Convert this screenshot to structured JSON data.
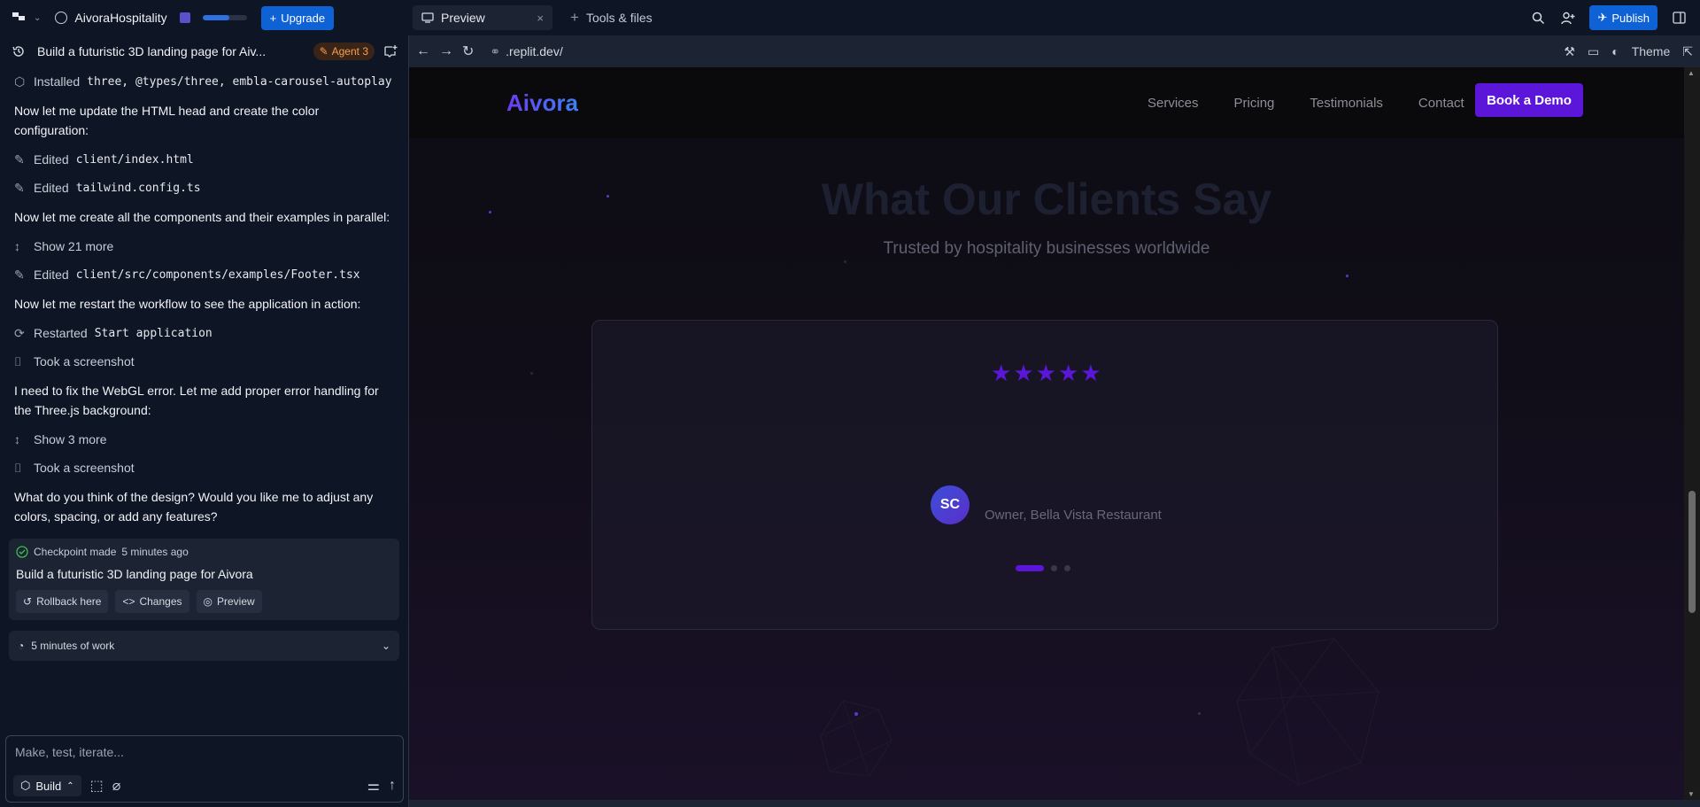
{
  "topbar": {
    "project_name": "AivoraHospitality",
    "upgrade_label": "Upgrade",
    "usage_fraction": 0.6,
    "tabs": [
      {
        "label": "Preview"
      },
      {
        "label": "Tools & files"
      }
    ],
    "publish_label": "Publish"
  },
  "chat": {
    "title": "Build a futuristic 3D landing page for Aiv...",
    "agent_badge": "Agent 3",
    "items": [
      {
        "type": "action",
        "icon": "package-icon",
        "text": "Installed ",
        "code": "three, @types/three, embla-carousel-autoplay"
      },
      {
        "type": "message",
        "text": "Now let me update the HTML head and create the color configuration:"
      },
      {
        "type": "action",
        "icon": "edit-icon",
        "text": "Edited ",
        "code": "client/index.html"
      },
      {
        "type": "action",
        "icon": "edit-icon",
        "text": "Edited ",
        "code": "tailwind.config.ts"
      },
      {
        "type": "message",
        "text": "Now let me create all the components and their examples in parallel:"
      },
      {
        "type": "action",
        "icon": "expand-icon",
        "text": "Show 21 more",
        "code": ""
      },
      {
        "type": "action",
        "icon": "edit-icon",
        "text": "Edited ",
        "code": "client/src/components/examples/Footer.tsx"
      },
      {
        "type": "message",
        "text": "Now let me restart the workflow to see the application in action:"
      },
      {
        "type": "action",
        "icon": "refresh-icon",
        "text": "Restarted ",
        "code": "Start application"
      },
      {
        "type": "action",
        "icon": "camera-icon",
        "text": "Took a screenshot",
        "code": ""
      },
      {
        "type": "message",
        "text": "I need to fix the WebGL error. Let me add proper error handling for the Three.js background:"
      },
      {
        "type": "action",
        "icon": "expand-icon",
        "text": "Show 3 more",
        "code": ""
      },
      {
        "type": "action",
        "icon": "camera-icon",
        "text": "Took a screenshot",
        "code": ""
      },
      {
        "type": "message",
        "text": "What do you think of the design? Would you like me to adjust any colors, spacing, or add any features?"
      }
    ],
    "checkpoint": {
      "status": "Checkpoint made",
      "time": "5 minutes ago",
      "title": "Build a futuristic 3D landing page for Aivora",
      "rollback_label": "Rollback here",
      "changes_label": "Changes",
      "preview_label": "Preview"
    },
    "work_label": "5 minutes of work",
    "composer_placeholder": "Make, test, iterate...",
    "build_label": "Build"
  },
  "browser": {
    "url": ".replit.dev/",
    "theme_label": "Theme"
  },
  "site": {
    "logo": "Aivora",
    "nav_links": [
      "Services",
      "Pricing",
      "Testimonials",
      "Contact"
    ],
    "cta_label": "Book a Demo",
    "section_title": "What Our Clients Say",
    "section_subtitle": "Trusted by hospitality businesses worldwide",
    "testimonial": {
      "rating": 5,
      "quote": "",
      "initials": "SC",
      "name": "",
      "role": "Owner, Bella Vista Restaurant"
    },
    "carousel_count": 3,
    "carousel_active": 1
  },
  "colors": {
    "accent_blue": "#0f62d6",
    "site_purple": "#5b16d9",
    "agent_orange": "#f6a04d"
  }
}
